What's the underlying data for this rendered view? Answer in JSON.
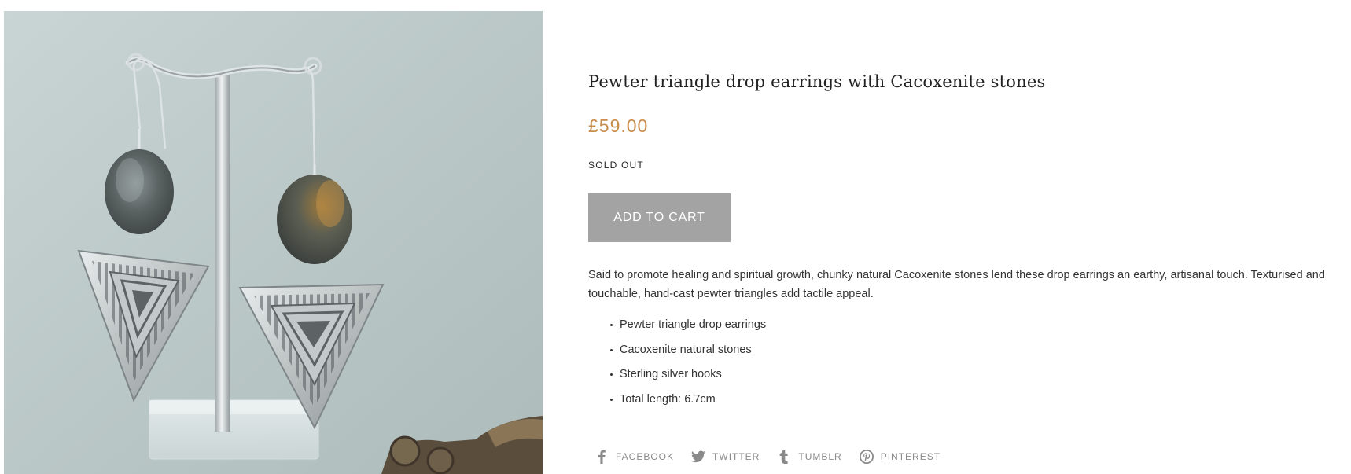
{
  "product": {
    "title": "Pewter triangle drop earrings with Cacoxenite stones",
    "price": "£59.00",
    "availability": "SOLD OUT",
    "add_to_cart_label": "ADD TO CART",
    "description": "Said to promote healing and spiritual growth, chunky natural Cacoxenite stones lend these drop earrings an earthy, artisanal touch. Texturised and touchable, hand-cast pewter triangles add tactile appeal.",
    "features": [
      "Pewter triangle drop earrings",
      "Cacoxenite natural stones",
      "Sterling silver hooks",
      "Total length: 6.7cm"
    ],
    "image": {
      "alt_icon": "product-photo"
    }
  },
  "share": {
    "links": [
      {
        "label": "FACEBOOK",
        "icon": "facebook-icon"
      },
      {
        "label": "TWITTER",
        "icon": "twitter-icon"
      },
      {
        "label": "TUMBLR",
        "icon": "tumblr-icon"
      },
      {
        "label": "PINTEREST",
        "icon": "pinterest-icon"
      }
    ]
  },
  "colors": {
    "price": "#c88c4b",
    "button_bg": "#a3a3a3",
    "button_text": "#ffffff",
    "share_text": "#8a8a8a",
    "image_bg": "#bfcbcb"
  }
}
